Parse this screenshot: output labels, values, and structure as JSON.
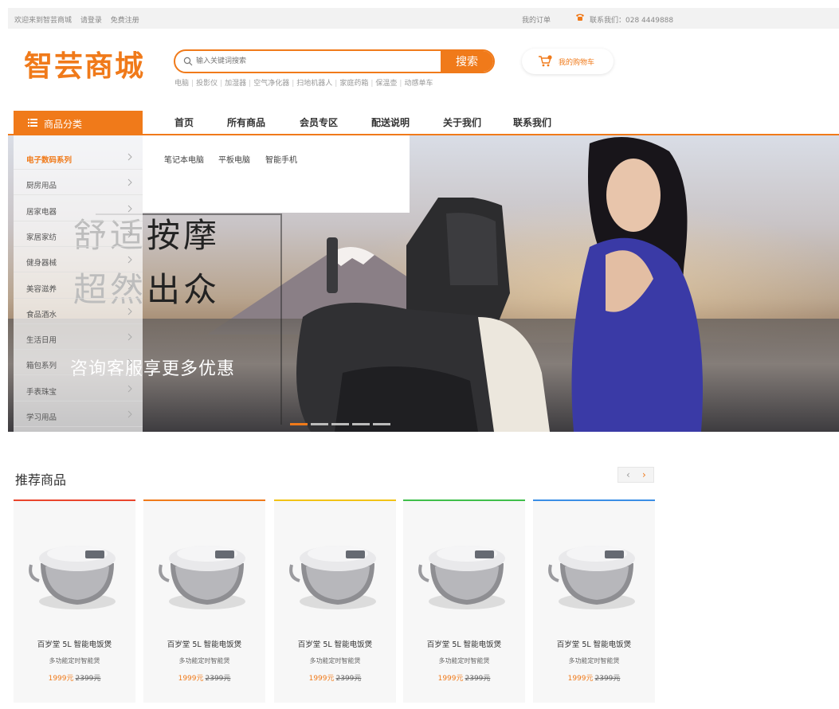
{
  "topbar": {
    "welcome": "欢迎来到智芸商城",
    "login": "请登录",
    "register": "免费注册",
    "orders": "我的订单",
    "phone": "联系我们：028 4449888"
  },
  "header": {
    "logo": "智芸商城",
    "search_placeholder": "输入关键词搜索",
    "search_button": "搜索",
    "hotwords": [
      "电脑",
      "投影仪",
      "加湿器",
      "空气净化器",
      "扫地机器人",
      "家庭药箱",
      "保温壶",
      "动感单车"
    ],
    "cart": "我的购物车"
  },
  "nav": {
    "category_button": "商品分类",
    "items": [
      "首页",
      "所有商品",
      "会员专区",
      "配送说明",
      "关于我们",
      "联系我们"
    ],
    "active_index": 0
  },
  "categories": {
    "items": [
      "电子数码系列",
      "厨房用品",
      "居家电器",
      "家居家纺",
      "健身器械",
      "美容滋养",
      "食品酒水",
      "生活日用",
      "箱包系列",
      "手表珠宝",
      "学习用品"
    ],
    "active_index": 0
  },
  "submenu": {
    "items": [
      "笔记本电脑",
      "平板电脑",
      "智能手机"
    ]
  },
  "banner": {
    "line1": "舒适按摩",
    "line2": "超然出众",
    "tagline": "咨询客服享更多优惠",
    "slide_count": 5,
    "active_slide": 0
  },
  "recommend": {
    "title": "推荐商品",
    "prev": "‹",
    "next": "›",
    "products": [
      {
        "name": "百岁堂 5L 智能电饭煲",
        "sub": "多功能定时智能煲",
        "price": "1999元",
        "old_price": "2399元",
        "accent": "#e9452c"
      },
      {
        "name": "百岁堂 5L 智能电饭煲",
        "sub": "多功能定时智能煲",
        "price": "1999元",
        "old_price": "2399元",
        "accent": "#f07a1a"
      },
      {
        "name": "百岁堂 5L 智能电饭煲",
        "sub": "多功能定时智能煲",
        "price": "1999元",
        "old_price": "2399元",
        "accent": "#f2c316"
      },
      {
        "name": "百岁堂 5L 智能电饭煲",
        "sub": "多功能定时智能煲",
        "price": "1999元",
        "old_price": "2399元",
        "accent": "#3fbf4a"
      },
      {
        "name": "百岁堂 5L 智能电饭煲",
        "sub": "多功能定时智能煲",
        "price": "1999元",
        "old_price": "2399元",
        "accent": "#3a8ee6"
      }
    ]
  },
  "colors": {
    "accent": "#f07a1a",
    "topbar_bg": "#f2f2f2"
  }
}
